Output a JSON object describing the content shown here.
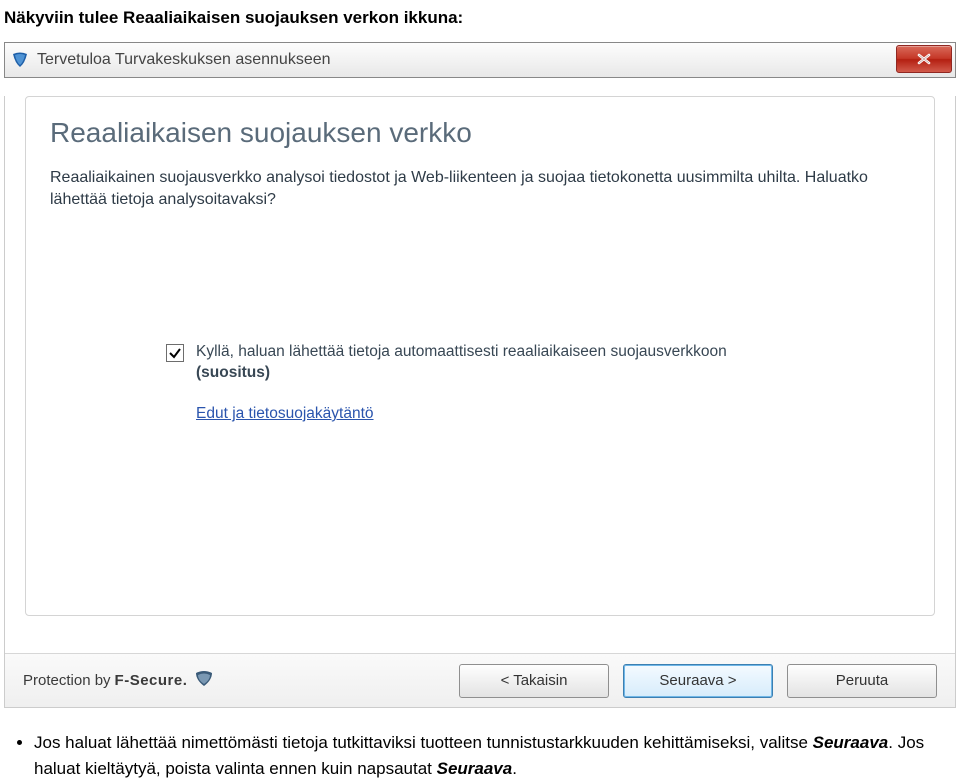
{
  "doc": {
    "intro": "Näkyviin tulee Reaaliaikaisen suojauksen verkon ikkuna:",
    "bullet_text": "Jos haluat lähettää nimettömästi tietoja tutkittaviksi tuotteen tunnistustarkkuuden kehittämiseksi, valitse ",
    "bullet_btn": "Seuraava",
    "bullet_tail": ". Jos haluat kieltäytyä, poista valinta ennen kuin napsautat ",
    "bullet_btn2": "Seuraava",
    "bullet_tail2": "."
  },
  "window": {
    "title": "Tervetuloa Turvakeskuksen asennukseen",
    "heading": "Reaaliaikaisen suojauksen verkko",
    "description": "Reaaliaikainen suojausverkko analysoi tiedostot ja Web-liikenteen ja suojaa tietokonetta uusimmilta uhilta. Haluatko lähettää tietoja analysoitavaksi?",
    "checkbox_label_main": "Kyllä, haluan lähettää tietoja automaattisesti reaaliaikaiseen suojausverkkoon",
    "checkbox_label_bold": "(suositus)",
    "link": "Edut ja tietosuojakäytäntö",
    "brand_prefix": "Protection by",
    "brand_name": "F-Secure.",
    "btn_back": "<  Takaisin",
    "btn_next": "Seuraava  >",
    "btn_cancel": "Peruuta"
  }
}
